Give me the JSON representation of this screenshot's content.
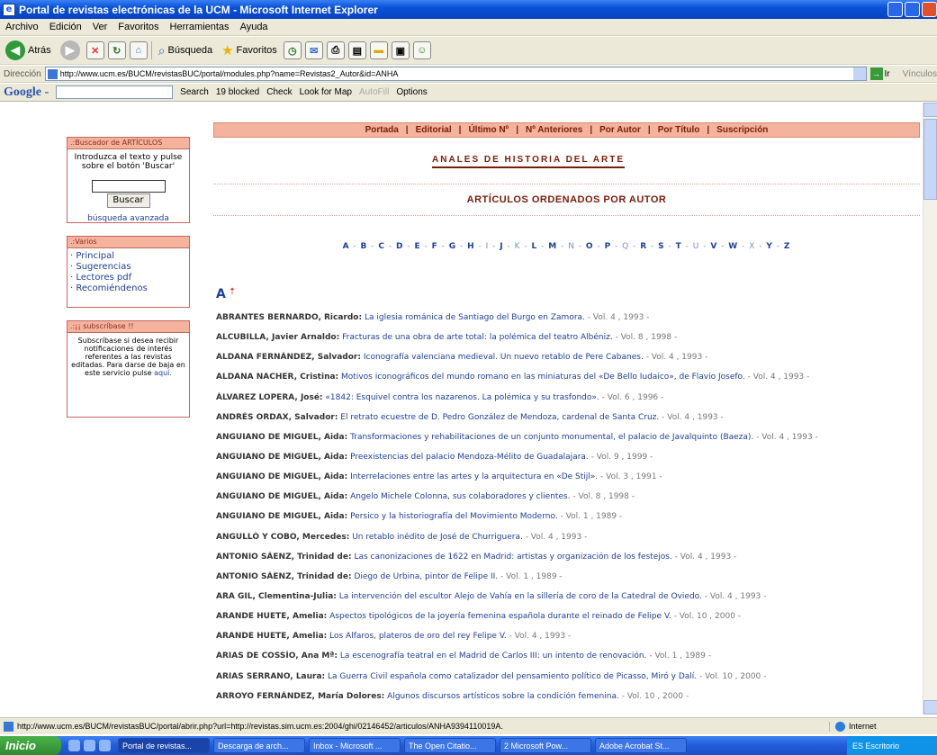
{
  "window": {
    "title": "Portal de revistas electrónicas de la UCM - Microsoft Internet Explorer"
  },
  "menu": [
    "Archivo",
    "Edición",
    "Ver",
    "Favoritos",
    "Herramientas",
    "Ayuda"
  ],
  "toolbar": {
    "back_label": "Atrás",
    "search_label": "Búsqueda",
    "favorites_label": "Favoritos"
  },
  "address": {
    "label": "Dirección",
    "url": "http://www.ucm.es/BUCM/revistasBUC/portal/modules.php?name=Revistas2_Autor&id=ANHA",
    "go_label": "Ir",
    "links_label": "Vínculos"
  },
  "google": {
    "logo": "Google -",
    "search": "Search",
    "blocked": "19 blocked",
    "check": "Check",
    "lookup": "Look for Map",
    "autofill": "AutoFill",
    "options": "Options"
  },
  "sidebar": {
    "search_box": {
      "header": ".:Buscador de ARTÍCULOS",
      "instructions": "Introduzca el texto y pulse sobre el botón 'Buscar'",
      "button": "Buscar",
      "advanced": "búsqueda avanzada"
    },
    "misc": {
      "header": ".:Varios",
      "items": [
        "· Principal",
        "· Sugerencias",
        "· Lectores pdf",
        "· Recomiéndenos"
      ]
    },
    "subscribe": {
      "header": ".:¡¡ subscríbase !!",
      "text": "Subscríbase si desea recibir notificaciones de interés referentes a las revistas editadas. Para darse de baja en este servicio pulse",
      "link": "aquí."
    }
  },
  "nav": [
    "Portada",
    "Editorial",
    "Último Nº",
    "Nº Anteriores",
    "Por Autor",
    "Por Título",
    "Suscripción"
  ],
  "journal_title": "ANALES DE HISTORIA DEL ARTE",
  "heading": "ARTÍCULOS ORDENADOS POR AUTOR",
  "alphabet": [
    {
      "l": "A",
      "on": true
    },
    {
      "l": "B",
      "on": true
    },
    {
      "l": "C",
      "on": true
    },
    {
      "l": "D",
      "on": true
    },
    {
      "l": "E",
      "on": true
    },
    {
      "l": "F",
      "on": true
    },
    {
      "l": "G",
      "on": true
    },
    {
      "l": "H",
      "on": true
    },
    {
      "l": "I",
      "on": false
    },
    {
      "l": "J",
      "on": true
    },
    {
      "l": "K",
      "on": false
    },
    {
      "l": "L",
      "on": true
    },
    {
      "l": "M",
      "on": true
    },
    {
      "l": "N",
      "on": false
    },
    {
      "l": "O",
      "on": true
    },
    {
      "l": "P",
      "on": true
    },
    {
      "l": "Q",
      "on": false
    },
    {
      "l": "R",
      "on": true
    },
    {
      "l": "S",
      "on": true
    },
    {
      "l": "T",
      "on": true
    },
    {
      "l": "U",
      "on": false
    },
    {
      "l": "V",
      "on": true
    },
    {
      "l": "W",
      "on": true
    },
    {
      "l": "X",
      "on": false
    },
    {
      "l": "Y",
      "on": true
    },
    {
      "l": "Z",
      "on": true
    }
  ],
  "section_letter": "A",
  "articles": [
    {
      "author": "ABRANTES BERNARDO, Ricardo:",
      "title": "La iglesia románica de Santiago del Burgo en Zamora.",
      "vol": "- Vol. 4 , 1993 -"
    },
    {
      "author": "ALCUBILLA, Javier Arnaldo:",
      "title": "Fracturas de una obra de arte total: la polémica del teatro Albéniz.",
      "vol": "- Vol. 8 , 1998 -"
    },
    {
      "author": "ALDANA FERNÁNDEZ, Salvador:",
      "title": "Iconografía valenciana medieval. Un nuevo retablo de Pere Cabanes.",
      "vol": "- Vol. 4 , 1993 -"
    },
    {
      "author": "ALDANA NACHER, Cristina:",
      "title": "Motivos iconográficos del mundo romano en las miniaturas del «De Bello Iudaico», de Flavio Josefo.",
      "vol": "- Vol. 4 , 1993 -"
    },
    {
      "author": "ÁLVAREZ LOPERA, José:",
      "title": "«1842: Esquivel contra los nazarenos. La polémica y su trasfondo».",
      "vol": "- Vol. 6 , 1996 -"
    },
    {
      "author": "ANDRÉS ORDAX, Salvador:",
      "title": "El retrato ecuestre de D. Pedro González de Mendoza, cardenal de Santa Cruz.",
      "vol": "- Vol. 4 , 1993 -"
    },
    {
      "author": "ANGUIANO DE MIGUEL, Aida:",
      "title": "Transformaciones y rehabilitaciones de un conjunto monumental, el palacio de Javalquinto (Baeza).",
      "vol": "- Vol. 4 , 1993 -"
    },
    {
      "author": "ANGUIANO DE MIGUEL, Aida:",
      "title": "Preexistencias del palacio Mendoza-Mélito de Guadalajara.",
      "vol": "- Vol. 9 , 1999 -"
    },
    {
      "author": "ANGUIANO DE MIGUEL, Aida:",
      "title": "Interrelaciones entre las artes y la arquitectura en «De Stijl».",
      "vol": "- Vol. 3 , 1991 -"
    },
    {
      "author": "ANGUIANO DE MIGUEL, Aida:",
      "title": "Angelo Michele Colonna, sus colaboradores y clientes.",
      "vol": "- Vol. 8 , 1998 -"
    },
    {
      "author": "ANGUIANO DE MIGUEL, Aida:",
      "title": "Persico y la historiografía del Movimiento Moderno.",
      "vol": "- Vol. 1 , 1989 -"
    },
    {
      "author": "ANGULLÓ Y COBO, Mercedes:",
      "title": "Un retablo inédito de José de Churriguera.",
      "vol": "- Vol. 4 , 1993 -"
    },
    {
      "author": "ANTONIO SÁENZ, Trinidad de:",
      "title": "Las canonizaciones de 1622 en Madrid: artistas y organización de los festejos.",
      "vol": "- Vol. 4 , 1993 -"
    },
    {
      "author": "ANTONIO SÁENZ, Trinidad de:",
      "title": "Diego de Urbina, pintor de Felipe II.",
      "vol": "- Vol. 1 , 1989 -"
    },
    {
      "author": "ARA GIL, Clementina-Julia:",
      "title": "La intervención del escultor Alejo de Vahía en la sillería de coro de la Catedral de Oviedo.",
      "vol": "- Vol. 4 , 1993 -"
    },
    {
      "author": "ARANDE HUETE, Amelia:",
      "title": "Aspectos tipológicos de la joyería femenina española durante el reinado de Felipe V.",
      "vol": "- Vol. 10 , 2000 -"
    },
    {
      "author": "ARANDE HUETE, Amelia:",
      "title": "Los Alfaros, plateros de oro del rey Felipe V.",
      "vol": "- Vol. 4 , 1993 -"
    },
    {
      "author": "ARIAS DE COSSÍO, Ana Mª:",
      "title": "La escenografía teatral en el Madrid de Carlos III: un intento de renovación.",
      "vol": "- Vol. 1 , 1989 -"
    },
    {
      "author": "ARIAS SERRANO, Laura:",
      "title": "La Guerra Civil española como catalizador del pensamiento político de Picasso, Miró y Dalí.",
      "vol": "- Vol. 10 , 2000 -"
    },
    {
      "author": "ARROYO FERNÁNDEZ, María Dolores:",
      "title": "Algunos discursos artísticos sobre la condición femenina.",
      "vol": "- Vol. 10 , 2000 -"
    }
  ],
  "status": {
    "url": "http://www.ucm.es/BUCM/revistasBUC/portal/abrir.php?url=http://revistas.sim.ucm.es:2004/ghi/02146452/articulos/ANHA9394110019A.",
    "zone": "Internet"
  },
  "taskbar": {
    "start": "Inicio",
    "buttons": [
      "Portal de revistas...",
      "Descarga de arch...",
      "Inbox - Microsoft ...",
      "The Open Citatio...",
      "2 Microsoft Pow...",
      "Adobe Acrobat St..."
    ],
    "tray": "ES  Escritorio"
  },
  "colors": {
    "accent": "#f4b39d",
    "link": "#1e3f9b",
    "title_red": "#7a1c0a"
  }
}
